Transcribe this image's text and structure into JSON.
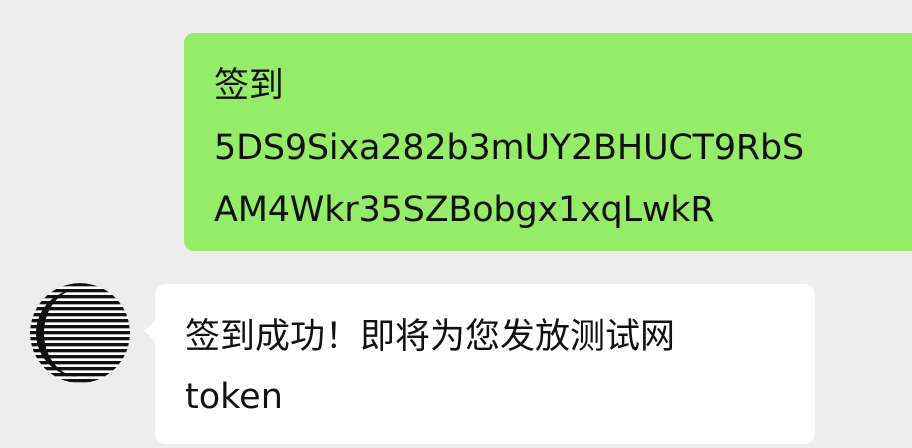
{
  "chat": {
    "sent_message": {
      "lines": [
        "签到",
        "5DS9Sixa282b3mUY2BHUCT9RbS",
        "AM4Wkr35SZBobgx1xqLwkR"
      ]
    },
    "received_message": {
      "lines": [
        "签到成功！即将为您发放测试网",
        "token"
      ]
    },
    "avatar_icon": "striped-circle-logo-icon"
  },
  "colors": {
    "background": "#ededed",
    "sent_bubble": "#95ec69",
    "received_bubble": "#ffffff",
    "text": "#111111"
  }
}
